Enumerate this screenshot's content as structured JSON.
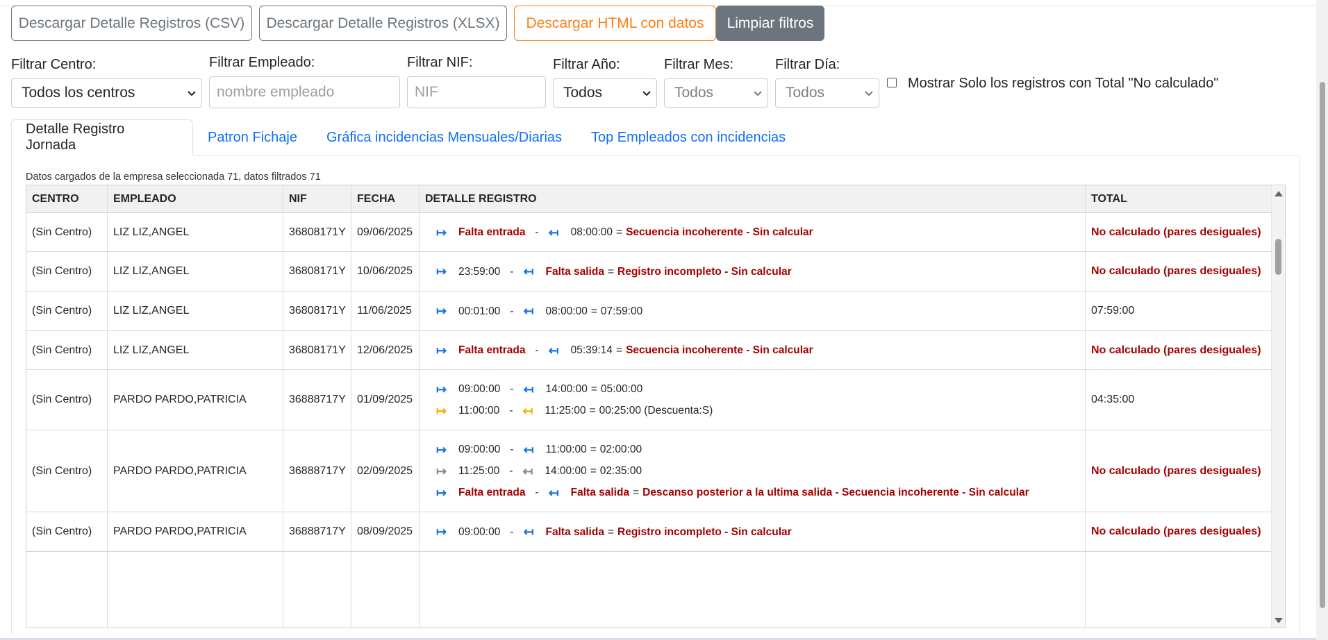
{
  "toolbar": {
    "csv_label": "Descargar Detalle Registros (CSV)",
    "xlsx_label": "Descargar Detalle Registros (XLSX)",
    "html_label": "Descargar HTML con datos",
    "clear_label": "Limpiar filtros"
  },
  "filters": {
    "centro": {
      "label": "Filtrar Centro:",
      "value": "Todos los centros"
    },
    "empleado": {
      "label": "Filtrar Empleado:",
      "placeholder": "nombre empleado"
    },
    "nif": {
      "label": "Filtrar NIF:",
      "placeholder": "NIF"
    },
    "anio": {
      "label": "Filtrar Año:",
      "value": "Todos"
    },
    "mes": {
      "label": "Filtrar Mes:",
      "value": "Todos"
    },
    "dia": {
      "label": "Filtrar Día:",
      "value": "Todos"
    },
    "solo_no_calculado": {
      "label": "Mostrar Solo los registros con Total \"No calculado\"",
      "checked": false
    }
  },
  "tabs": [
    {
      "label": "Detalle Registro Jornada",
      "active": true
    },
    {
      "label": "Patron Fichaje",
      "active": false
    },
    {
      "label": "Gráfica incidencias Mensuales/Diarias",
      "active": false
    },
    {
      "label": "Top Empleados con incidencias",
      "active": false
    }
  ],
  "info_text": "Datos cargados de la empresa seleccionada 71, datos filtrados 71",
  "table": {
    "columns": [
      "CENTRO",
      "EMPLEADO",
      "NIF",
      "FECHA",
      "DETALLE REGISTRO",
      "TOTAL"
    ],
    "rows": [
      {
        "centro": "(Sin Centro)",
        "empleado": "LIZ LIZ,ANGEL",
        "nif": "36808171Y",
        "fecha": "09/06/2025",
        "detalle": [
          {
            "in": "Falta entrada",
            "out": "08:00:00",
            "eq": "=",
            "res": "Secuencia incoherente - Sin calcular"
          }
        ],
        "total": "No calculado (pares desiguales)"
      },
      {
        "centro": "(Sin Centro)",
        "empleado": "LIZ LIZ,ANGEL",
        "nif": "36808171Y",
        "fecha": "10/06/2025",
        "detalle": [
          {
            "in": "23:59:00",
            "out": "Falta salida",
            "eq": "=",
            "res": "Registro incompleto - Sin calcular"
          }
        ],
        "total": "No calculado (pares desiguales)"
      },
      {
        "centro": "(Sin Centro)",
        "empleado": "LIZ LIZ,ANGEL",
        "nif": "36808171Y",
        "fecha": "11/06/2025",
        "detalle": [
          {
            "in": "00:01:00",
            "out": "08:00:00",
            "eq": "=",
            "res": "07:59:00"
          }
        ],
        "total": "07:59:00"
      },
      {
        "centro": "(Sin Centro)",
        "empleado": "LIZ LIZ,ANGEL",
        "nif": "36808171Y",
        "fecha": "12/06/2025",
        "detalle": [
          {
            "in": "Falta entrada",
            "out": "05:39:14",
            "eq": "=",
            "res": "Secuencia incoherente - Sin calcular"
          }
        ],
        "total": "No calculado (pares desiguales)"
      },
      {
        "centro": "(Sin Centro)",
        "empleado": "PARDO PARDO,PATRICIA",
        "nif": "36888717Y",
        "fecha": "01/09/2025",
        "detalle": [
          {
            "in": "09:00:00",
            "out": "14:00:00",
            "eq": "=",
            "res": "05:00:00"
          },
          {
            "in": "11:00:00",
            "out": "11:25:00",
            "eq": "=",
            "res": "00:25:00 (Descuenta:S)"
          }
        ],
        "total": "04:35:00"
      },
      {
        "centro": "(Sin Centro)",
        "empleado": "PARDO PARDO,PATRICIA",
        "nif": "36888717Y",
        "fecha": "02/09/2025",
        "detalle": [
          {
            "in": "09:00:00",
            "out": "11:00:00",
            "eq": "=",
            "res": "02:00:00"
          },
          {
            "in": "11:25:00",
            "out": "14:00:00",
            "eq": "=",
            "res": "02:35:00"
          },
          {
            "in": "Falta entrada",
            "out": "Falta salida",
            "eq": "=",
            "res": "Descanso posterior a la ultima salida - Secuencia incoherente - Sin calcular"
          }
        ],
        "total": "No calculado (pares desiguales)"
      },
      {
        "centro": "(Sin Centro)",
        "empleado": "PARDO PARDO,PATRICIA",
        "nif": "36888717Y",
        "fecha": "08/09/2025",
        "detalle": [
          {
            "in": "09:00:00",
            "out": "Falta salida",
            "eq": "=",
            "res": "Registro incompleto - Sin calcular"
          }
        ],
        "total": "No calculado (pares desiguales)"
      }
    ]
  },
  "colors": {
    "accent_blue": "#0d6efd",
    "arrow_blue": "#1a73e8",
    "arrow_yellow": "#f0b400",
    "arrow_gray": "#8a8a8a",
    "error_red": "#a40000",
    "warning_orange": "#fd7e14",
    "secondary_gray": "#6c757d"
  }
}
